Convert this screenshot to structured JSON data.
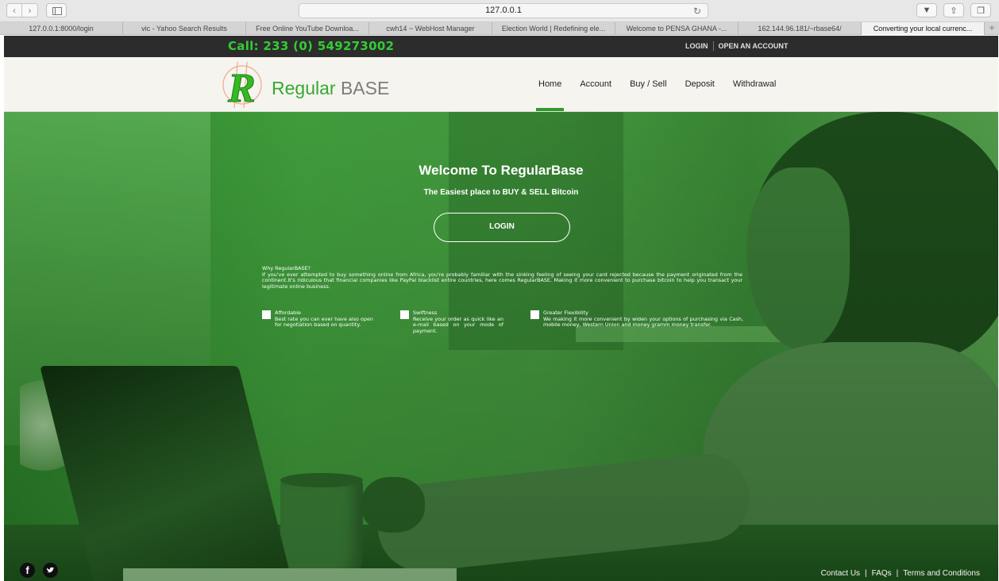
{
  "browser": {
    "url": "127.0.0.1",
    "tabs": [
      "127.0.0.1:8000/login",
      "vic - Yahoo Search Results",
      "Free Online YouTube Downloa...",
      "cwh14 ~ WebHost Manager",
      "Election World | Redefining ele...",
      "Welcome to PENSA GHANA -...",
      "162.144.96.181/~rbase64/",
      "Converting your local currenc..."
    ],
    "new_tab": "+"
  },
  "topbar": {
    "call": "Call: 233 (0) 549273002",
    "login": "LOGIN",
    "open_account": "OPEN AN ACCOUNT"
  },
  "header": {
    "brand_regular": "Regular",
    "brand_base": "BASE",
    "logo_letter": "R",
    "nav": [
      "Home",
      "Account",
      "Buy / Sell",
      "Deposit",
      "Withdrawal"
    ]
  },
  "hero": {
    "title": "Welcome To RegularBase",
    "tagline": "The Easiest place to BUY & SELL Bitcoin",
    "login_button": "LOGIN",
    "why_title": "Why RegularBASE?",
    "why_text": "If you've ever attempted to buy something online from Africa, you're probably familiar with the sinking feeling of seeing your card rejected because the payment originated from the continent.It's ridiculous that financial companies like PayPal blacklist entire countries, here comes RegularBASE. Making it more convenient to purchase bitcoin to help you transact your legitimate online business.",
    "features": [
      {
        "title": "Affordable",
        "text": "Best rate you can ever have also open for negotiation based on quantity."
      },
      {
        "title": "Swiftness",
        "text": "Receive your order as quick like an e-mail based on your mode of payment."
      },
      {
        "title": "Greater Flexibility",
        "text": "We making it more convenient by widen your options of purchasing via Cash, mobile money, Western Union and money gramm money transfer."
      }
    ]
  },
  "footer": {
    "social_facebook": "f",
    "social_twitter": "t",
    "links": [
      "Contact Us",
      "FAQs",
      "Terms and Conditions"
    ],
    "separator": "|"
  }
}
